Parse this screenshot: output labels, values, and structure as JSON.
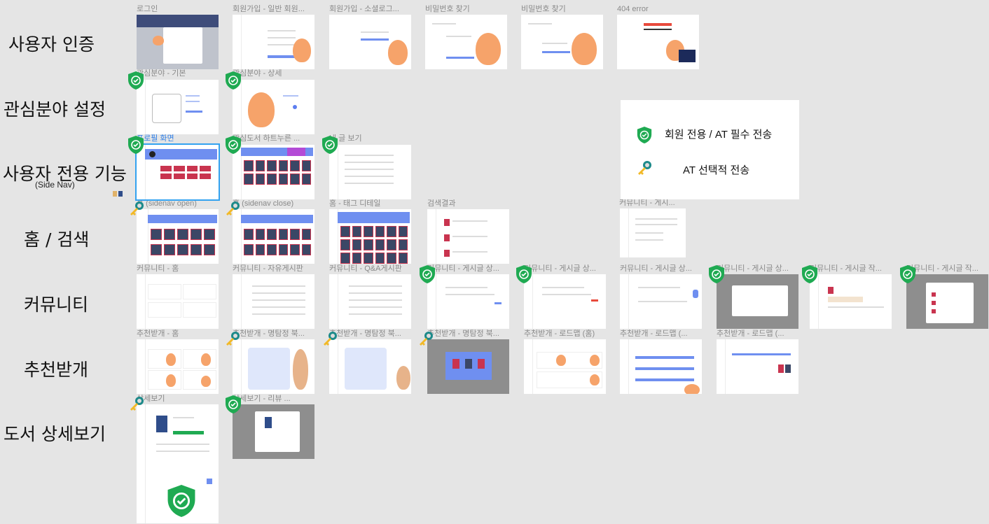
{
  "rows": [
    {
      "title": "사용자 인증"
    },
    {
      "title": "관심분야 설정"
    },
    {
      "title": "사용자 전용 기능",
      "subtitle": "(Side Nav)"
    },
    {
      "title": "홈 / 검색"
    },
    {
      "title": "커뮤니티"
    },
    {
      "title": "추천받개"
    },
    {
      "title": "도서 상세보기"
    }
  ],
  "frames": [
    {
      "label": "로그인"
    },
    {
      "label": "회원가입 - 일반 회원..."
    },
    {
      "label": "회원가입 - 소셜로그..."
    },
    {
      "label": "비밀번호 찾기"
    },
    {
      "label": "비밀번호 찾기"
    },
    {
      "label": "404 error"
    },
    {
      "label": "관심분야 - 기본"
    },
    {
      "label": "관심분야 - 상세"
    },
    {
      "label": "프로필 화면"
    },
    {
      "label": "관심도서 하트누른 ..."
    },
    {
      "label": "내 글 보기"
    },
    {
      "label": "홈 (sidenav open)"
    },
    {
      "label": "홈 (sidenav close)"
    },
    {
      "label": "홈 - 태그 디테일"
    },
    {
      "label": "검색결과"
    },
    {
      "label": "커뮤니티 - 게시..."
    },
    {
      "label": "커뮤니티 - 홈"
    },
    {
      "label": "커뮤니티 - 자유게시판"
    },
    {
      "label": "커뮤니티 - Q&A게시판"
    },
    {
      "label": "커뮤니티 - 게시글 상..."
    },
    {
      "label": "커뮤니티 - 게시글 상..."
    },
    {
      "label": "커뮤니티 - 게시글 상..."
    },
    {
      "label": "커뮤니티 - 게시글 상..."
    },
    {
      "label": "커뮤니티 - 게시글 작..."
    },
    {
      "label": "커뮤니티 - 게시글 작..."
    },
    {
      "label": "추천받개 - 홈"
    },
    {
      "label": "추천받개 - 명탐정 북..."
    },
    {
      "label": "추천받개 - 명탐정 북..."
    },
    {
      "label": "추천받개 - 명탐정 북..."
    },
    {
      "label": "추천받개 - 로드맵 (홈)"
    },
    {
      "label": "추천받개 - 로드맵 (..."
    },
    {
      "label": "추천받개 - 로드맵 (..."
    },
    {
      "label": "상세보기"
    },
    {
      "label": "상세보기 - 리뷰 ..."
    }
  ],
  "legend": {
    "member_only": "회원 전용 / AT 필수 전송",
    "optional": "AT 선택적 전송"
  },
  "colors": {
    "canvas": "#e5e5e5",
    "shield": "#1faa52",
    "key": "#f2b928",
    "selection": "#33a2f0",
    "accent_blue": "#6f8ff0"
  },
  "icons": {
    "member_only": "shield-check-icon",
    "optional": "key-icon"
  }
}
